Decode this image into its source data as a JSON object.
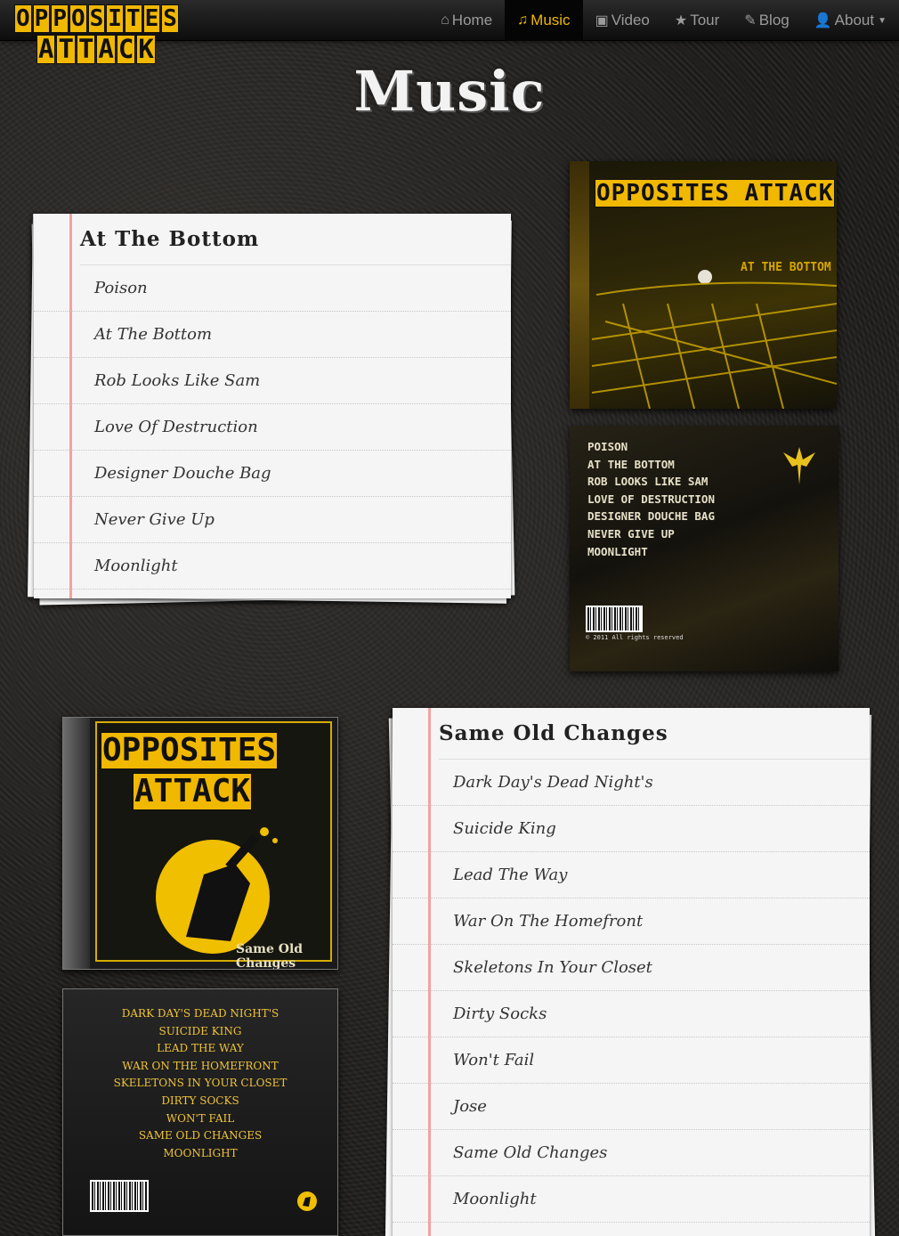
{
  "brand": {
    "line1": "OPPOSITES",
    "line2": "ATTACK"
  },
  "nav": {
    "items": [
      {
        "icon": "home-icon",
        "glyph": "⌂",
        "label": "Home",
        "active": false
      },
      {
        "icon": "music-icon",
        "glyph": "♫",
        "label": "Music",
        "active": true
      },
      {
        "icon": "film-icon",
        "glyph": "▣",
        "label": "Video",
        "active": false
      },
      {
        "icon": "star-icon",
        "glyph": "★",
        "label": "Tour",
        "active": false
      },
      {
        "icon": "pencil-icon",
        "glyph": "✎",
        "label": "Blog",
        "active": false
      },
      {
        "icon": "user-icon",
        "glyph": "👤",
        "label": "About",
        "active": false
      }
    ]
  },
  "page": {
    "title": "Music"
  },
  "albums": [
    {
      "title": "At The Bottom",
      "tracks": [
        "Poison",
        "At The Bottom",
        "Rob Looks Like Sam",
        "Love Of Destruction",
        "Designer Douche Bag",
        "Never Give Up",
        "Moonlight"
      ],
      "front_band": "OPPOSITES ATTACK",
      "front_subtitle": "AT THE BOTTOM",
      "back_tracks": [
        "POISON",
        "AT THE BOTTOM",
        "ROB LOOKS LIKE SAM",
        "LOVE OF DESTRUCTION",
        "DESIGNER DOUCHE BAG",
        "NEVER GIVE UP",
        "MOONLIGHT"
      ],
      "back_copyright": "© 2011 All rights reserved"
    },
    {
      "title": "Same Old Changes",
      "tracks": [
        "Dark Day's Dead Night's",
        "Suicide King",
        "Lead The Way",
        "War On The Homefront",
        "Skeletons In Your Closet",
        "Dirty Socks",
        "Won't Fail",
        "Jose",
        "Same Old Changes",
        "Moonlight"
      ],
      "front_band_line1": "OPPOSITES",
      "front_band_line2": "ATTACK",
      "front_subtitle": "Same Old Changes",
      "back_tracks": [
        "DARK DAY'S DEAD NIGHT'S",
        "SUICIDE KING",
        "LEAD THE WAY",
        "WAR ON THE HOMEFRONT",
        "SKELETONS IN YOUR CLOSET",
        "DIRTY SOCKS",
        "WON'T FAIL",
        "SAME OLD CHANGES",
        "MOONLIGHT"
      ]
    }
  ],
  "colors": {
    "accent": "#f1b800",
    "margin_line": "#f2a39f",
    "paper": "#f5f5f5"
  }
}
